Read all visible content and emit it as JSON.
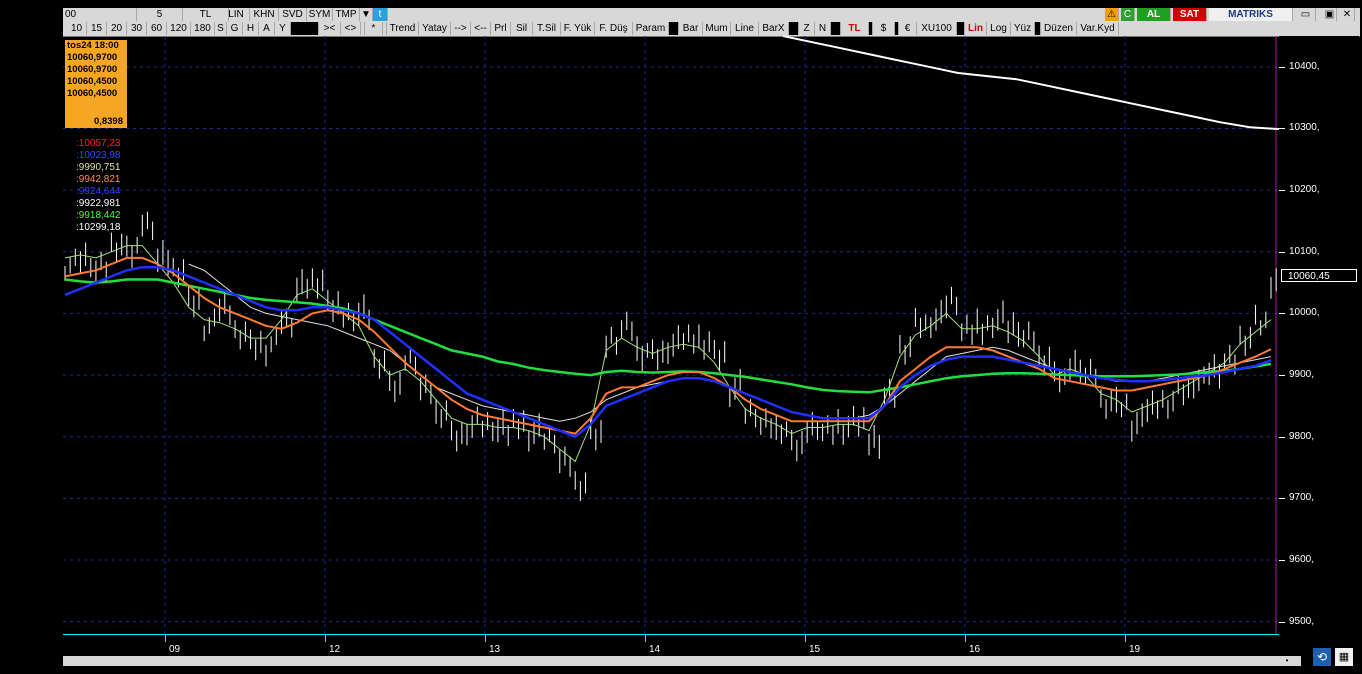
{
  "toolbar1": {
    "items": [
      "00",
      "5",
      "TL",
      "LIN",
      "KHN",
      "SVD",
      "SYM",
      "TMP"
    ],
    "buy": "AL",
    "sell": "SAT",
    "brand": "MATRIKS"
  },
  "toolbar2": {
    "items": [
      "10",
      "15",
      "20",
      "30",
      "60",
      "120",
      "180",
      "S",
      "G",
      "H",
      "A",
      "Y",
      "><",
      "<>",
      "*",
      "Trend",
      "Yatay",
      "-->",
      "<--",
      "Prl",
      "Sil",
      "T.Sil",
      "F. Yük",
      "F. Düş",
      "Param",
      "Bar",
      "Mum",
      "Line",
      "BarX",
      "Z",
      "N",
      "TL",
      "$",
      "€",
      "XU100",
      "Lin",
      "Log",
      "Yüz",
      "Düzen",
      "Var.Kyd"
    ]
  },
  "info": {
    "date": "tos24 18:00",
    "open": "10060,9700",
    "high": "10060,9700",
    "low": "10060,4500",
    "close": "10060,4500",
    "change": "0,8398"
  },
  "legend": [
    {
      "text": ":10057,23",
      "color": "#ff2020"
    },
    {
      "text": ":10023,98",
      "color": "#2a4dff"
    },
    {
      "text": ":9990,751",
      "color": "#e0e0a0"
    },
    {
      "text": ":9942,821",
      "color": "#ff9050"
    },
    {
      "text": ":9924,644",
      "color": "#3040ff"
    },
    {
      "text": ":9922,981",
      "color": "#ffffff"
    },
    {
      "text": ":9918,442",
      "color": "#40ff40"
    },
    {
      "text": ":10299,18",
      "color": "#ffffff"
    }
  ],
  "price_label": "10060,45",
  "colors": {
    "sma_orange": "#ff7a30",
    "sma_blue": "#2030ff",
    "sma_green": "#20e040",
    "sma_white": "#ffffff",
    "sma_light": "#c8f0a0",
    "bars": "#ffffff"
  },
  "chart_data": {
    "type": "line",
    "yaxis": {
      "ticks": [
        "10400,",
        "10300,",
        "10200,",
        "10100,",
        "10000,",
        "9900,",
        "9800,",
        "9700,",
        "9600,",
        "9500,"
      ],
      "range": [
        9480,
        10450
      ]
    },
    "xaxis": {
      "labels": [
        "09",
        "12",
        "13",
        "14",
        "15",
        "16",
        "19"
      ]
    },
    "series": [
      {
        "key": "price",
        "values": [
          10080,
          10090,
          10070,
          10110,
          10100,
          10150,
          10090,
          10070,
          10020,
          9980,
          10010,
          9970,
          9950,
          9950,
          9990,
          10040,
          10050,
          10010,
          10000,
          10000,
          9920,
          9880,
          9930,
          9880,
          9840,
          9800,
          9820,
          9820,
          9810,
          9820,
          9810,
          9800,
          9760,
          9720,
          9800,
          9960,
          9980,
          9940,
          9930,
          9950,
          9960,
          9960,
          9930,
          9880,
          9840,
          9820,
          9810,
          9780,
          9820,
          9810,
          9820,
          9820,
          9800,
          9870,
          9950,
          9980,
          9990,
          10020,
          9970,
          9980,
          9990,
          9980,
          9960,
          9930,
          9890,
          9920,
          9900,
          9860,
          9850,
          9820,
          9850,
          9860,
          9880,
          9890,
          9910,
          9920,
          9960,
          9980,
          10050
        ]
      },
      {
        "key": "sma_white",
        "values": [
          null,
          null,
          null,
          null,
          null,
          null,
          null,
          null,
          10080,
          10070,
          10050,
          10030,
          10010,
          10000,
          9995,
          9990,
          9985,
          9980,
          9970,
          9960,
          9950,
          9940,
          9920,
          9900,
          9880,
          9870,
          9860,
          9850,
          9845,
          9840,
          9835,
          9830,
          9825,
          9830,
          9840,
          9860,
          9870,
          9880,
          9885,
          9890,
          9895,
          9895,
          9890,
          9880,
          9870,
          9860,
          9850,
          9840,
          9835,
          9830,
          9830,
          9830,
          9835,
          9850,
          9870,
          9890,
          9910,
          9930,
          9935,
          9940,
          9945,
          9940,
          9930,
          9920,
          9910,
          9905,
          9900,
          9895,
          9890,
          9890,
          9890,
          9895,
          9900,
          9905,
          9910,
          9915,
          9920,
          9925,
          9930
        ]
      },
      {
        "key": "sma_green",
        "values": [
          10055,
          10052,
          10050,
          10052,
          10055,
          10055,
          10055,
          10050,
          10045,
          10040,
          10035,
          10030,
          10025,
          10022,
          10020,
          10018,
          10016,
          10012,
          10008,
          10000,
          9990,
          9980,
          9970,
          9960,
          9950,
          9940,
          9935,
          9930,
          9922,
          9918,
          9912,
          9908,
          9905,
          9902,
          9900,
          9905,
          9907,
          9905,
          9904,
          9905,
          9906,
          9905,
          9903,
          9900,
          9897,
          9893,
          9889,
          9885,
          9880,
          9876,
          9874,
          9873,
          9872,
          9876,
          9880,
          9885,
          9890,
          9895,
          9898,
          9900,
          9902,
          9903,
          9903,
          9902,
          9901,
          9900,
          9899,
          9898,
          9898,
          9898,
          9899,
          9900,
          9901,
          9903,
          9905,
          9907,
          9910,
          9914,
          9918
        ]
      },
      {
        "key": "sma_blue",
        "values": [
          10030,
          10040,
          10050,
          10060,
          10070,
          10075,
          10075,
          10070,
          10060,
          10050,
          10040,
          10030,
          10020,
          10010,
          10005,
          10005,
          10010,
          10010,
          10005,
          10000,
          9990,
          9970,
          9950,
          9930,
          9910,
          9890,
          9870,
          9860,
          9850,
          9840,
          9830,
          9820,
          9810,
          9800,
          9820,
          9850,
          9860,
          9870,
          9880,
          9890,
          9895,
          9895,
          9890,
          9880,
          9870,
          9860,
          9850,
          9840,
          9835,
          9830,
          9830,
          9830,
          9830,
          9850,
          9880,
          9900,
          9915,
          9925,
          9930,
          9930,
          9930,
          9925,
          9920,
          9915,
          9910,
          9905,
          9900,
          9895,
          9892,
          9890,
          9890,
          9892,
          9895,
          9898,
          9900,
          9905,
          9910,
          9915,
          9924
        ]
      },
      {
        "key": "sma_orange",
        "values": [
          10060,
          10065,
          10070,
          10080,
          10090,
          10090,
          10080,
          10065,
          10045,
          10025,
          10010,
          10000,
          9990,
          9980,
          9975,
          9985,
          10000,
          10005,
          10000,
          9990,
          9970,
          9945,
          9920,
          9900,
          9880,
          9860,
          9845,
          9835,
          9830,
          9825,
          9820,
          9815,
          9810,
          9805,
          9830,
          9870,
          9880,
          9880,
          9890,
          9900,
          9905,
          9905,
          9895,
          9880,
          9860,
          9845,
          9835,
          9825,
          9825,
          9825,
          9825,
          9825,
          9825,
          9850,
          9890,
          9910,
          9930,
          9945,
          9945,
          9945,
          9940,
          9930,
          9920,
          9910,
          9895,
          9890,
          9885,
          9880,
          9875,
          9875,
          9880,
          9885,
          9890,
          9895,
          9900,
          9910,
          9920,
          9930,
          9942
        ]
      },
      {
        "key": "sma_light",
        "values": [
          10090,
          10095,
          10090,
          10100,
          10110,
          10110,
          10080,
          10050,
          10010,
          9990,
          9985,
          9975,
          9960,
          9960,
          9990,
          10030,
          10040,
          10020,
          10000,
          9980,
          9930,
          9900,
          9910,
          9890,
          9860,
          9830,
          9820,
          9820,
          9815,
          9815,
          9810,
          9800,
          9780,
          9760,
          9820,
          9940,
          9960,
          9945,
          9935,
          9945,
          9950,
          9945,
          9920,
          9880,
          9845,
          9830,
          9820,
          9805,
          9815,
          9815,
          9820,
          9820,
          9810,
          9860,
          9930,
          9965,
          9980,
          10000,
          9975,
          9975,
          9980,
          9970,
          9955,
          9930,
          9900,
          9910,
          9900,
          9870,
          9860,
          9840,
          9850,
          9860,
          9875,
          9890,
          9905,
          9920,
          9950,
          9970,
          9990
        ]
      },
      {
        "key": "ma_long_white",
        "values": [
          10450,
          10440,
          10430,
          10420,
          10410,
          10400,
          10390,
          10385,
          10380,
          10370,
          10360,
          10350,
          10340,
          10330,
          10320,
          10310,
          10302,
          10299
        ]
      }
    ]
  },
  "x_axis_labels": [
    "09",
    "12",
    "13",
    "14",
    "15",
    "16",
    "19"
  ]
}
